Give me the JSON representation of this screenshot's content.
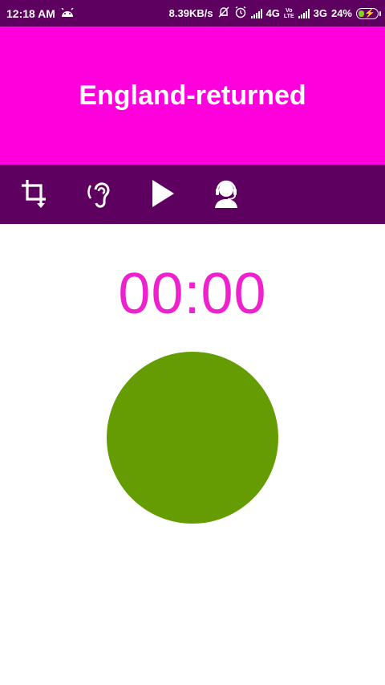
{
  "status_bar": {
    "time": "12:18 AM",
    "speed": "8.39KB/s",
    "network_1": "4G",
    "volte_top": "Vo",
    "volte_bottom": "LTE",
    "network_2": "3G",
    "battery": "24%",
    "icons": [
      "android-icon",
      "mute-icon",
      "alarm-icon",
      "signal-icon",
      "battery-charging-icon"
    ]
  },
  "header": {
    "title": "England-returned"
  },
  "toolbar": {
    "icons": [
      "crop-icon",
      "hearing-icon",
      "play-icon",
      "headset-user-icon"
    ]
  },
  "timer": {
    "value": "00:00"
  },
  "colors": {
    "status_bar": "#5e0060",
    "header": "#ff00dd",
    "toolbar": "#5e0060",
    "timer": "#ee22cc",
    "record_button": "#659c01"
  }
}
